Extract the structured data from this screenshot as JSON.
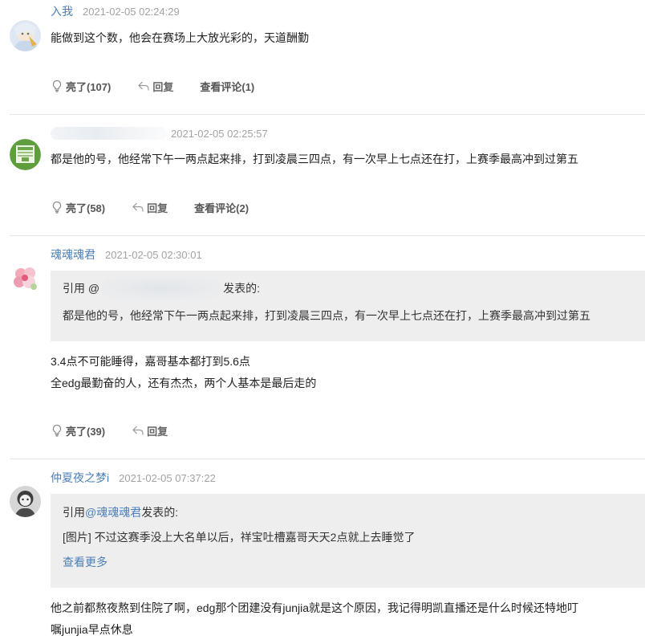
{
  "comments": [
    {
      "username": "入我",
      "time": "2021-02-05 02:24:29",
      "text": "能做到这个数，他会在赛场上大放光彩的，天道酬勤",
      "like": "亮了(107)",
      "reply": "回复",
      "view_replies": "查看评论(1)"
    },
    {
      "username": "",
      "time": "2021-02-05 02:25:57",
      "text": "都是他的号，他经常下午一两点起来排，打到凌晨三四点，有一次早上七点还在打，上赛季最高冲到过第五",
      "like": "亮了(58)",
      "reply": "回复",
      "view_replies": "查看评论(2)"
    },
    {
      "username": "魂魂魂君",
      "time": "2021-02-05 02:30:01",
      "quote": {
        "prefix": "引用 @",
        "suffix": "发表的:",
        "text": "都是他的号，他经常下午一两点起来排，打到凌晨三四点，有一次早上七点还在打，上赛季最高冲到过第五"
      },
      "text_line1": "3.4点不可能睡得，嘉哥基本都打到5.6点",
      "text_line2": "全edg最勤奋的人，还有杰杰，两个人基本是最后走的",
      "like": "亮了(39)",
      "reply": "回复"
    },
    {
      "username": "仲夏夜之梦i",
      "time": "2021-02-05 07:37:22",
      "quote": {
        "prefix": "引用 ",
        "mention": "@魂魂魂君",
        "suffix": " 发表的:",
        "text": "[图片] 不过这赛季没上大名单以后，祥宝吐槽嘉哥天天2点就上去睡觉了",
        "see_more": "查看更多"
      },
      "text_line1": "他之前都熬夜熬到住院了啊，edg那个团建没有junjia就是这个原因，我记得明凯直播还是什么时候还特地叮",
      "text_line2": "嘱junjia早点休息"
    }
  ],
  "colors": {
    "link": "#4c7fb8",
    "time": "#a3a3a3",
    "quote_bg": "#eeeeee",
    "divider": "#e6e6e6"
  },
  "icons": {
    "like": "lightbulb-icon",
    "reply": "reply-arrow-icon"
  }
}
